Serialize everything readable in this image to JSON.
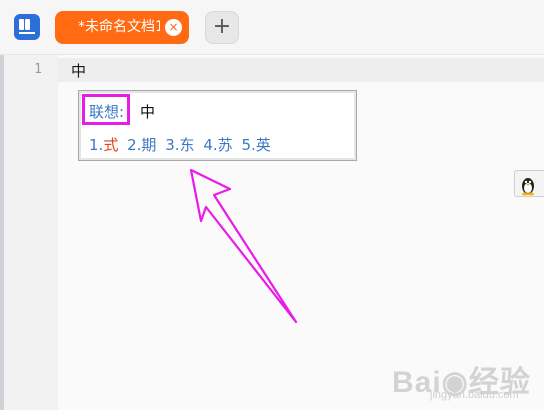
{
  "titlebar": {
    "app_icon": "text-editor-icon",
    "tab": {
      "label": "*未命名文档1",
      "close_icon": "close-icon",
      "color": "#ff6a13"
    },
    "new_tab_icon": "plus-icon",
    "new_tab_label": "+"
  },
  "editor": {
    "line_numbers": [
      "1"
    ],
    "lines": [
      "中"
    ]
  },
  "ime": {
    "prefix": "联想:",
    "input": "中",
    "candidates": [
      {
        "index": "1.",
        "word": "式",
        "selected": true
      },
      {
        "index": "2.",
        "word": "期",
        "selected": false
      },
      {
        "index": "3.",
        "word": "东",
        "selected": false
      },
      {
        "index": "4.",
        "word": "苏",
        "selected": false
      },
      {
        "index": "5.",
        "word": "英",
        "selected": false
      }
    ],
    "highlight_color": "#e81be8",
    "candidate_color": "#3b78c4",
    "selected_color": "#e0401c"
  },
  "annotation": {
    "arrow_icon": "pointer-arrow-icon",
    "color": "#e81be8"
  },
  "floater": {
    "icon": "penguin-icon"
  },
  "watermark": {
    "text": "Bai◉经验",
    "sub": "jingyan.baidu.com"
  }
}
